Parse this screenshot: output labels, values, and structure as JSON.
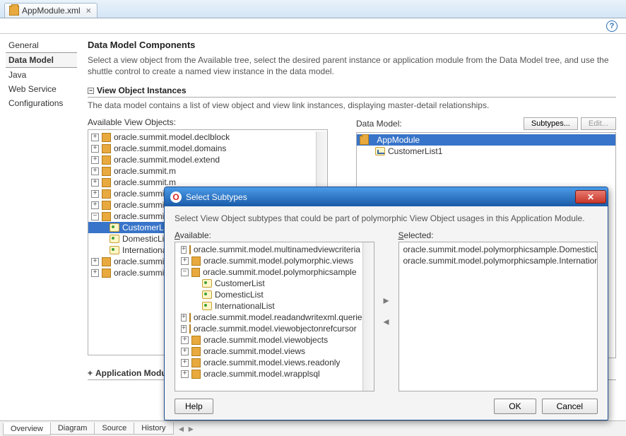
{
  "file_tab": {
    "label": "AppModule.xml",
    "close": "×"
  },
  "leftnav": {
    "general": "General",
    "data_model": "Data Model",
    "java": "Java",
    "web_service": "Web Service",
    "configurations": "Configurations"
  },
  "main": {
    "title": "Data Model Components",
    "desc": "Select a view object from the Available tree, select the desired parent instance or application module from the Data Model tree, and use the shuttle control to create a named view instance in the data model.",
    "section_vo": "View Object Instances",
    "section_vo_desc": "The data model contains a list of view object and view link instances, displaying master-detail relationships.",
    "avail_label": "Available View Objects:",
    "dm_label": "Data Model:",
    "btn_subtypes": "Subtypes...",
    "btn_edit": "Edit...",
    "section_ami": "Application Module Instances",
    "avail_tree": [
      "oracle.summit.model.declblock",
      "oracle.summit.model.domains",
      "oracle.summit.model.extend",
      "oracle.summit.m",
      "oracle.summit.m",
      "oracle.summit.m",
      "oracle.summit.m"
    ],
    "avail_tree_open": "oracle.summit.m",
    "avail_children": {
      "customer": "CustomerLis",
      "domestic": "DomesticList",
      "international": "Internationa"
    },
    "avail_tree_tail": [
      "oracle.summit.m",
      "oracle.summit.m"
    ],
    "dm_root": "AppModule",
    "dm_child": "CustomerList1"
  },
  "modal": {
    "title": "Select Subtypes",
    "desc": "Select View Object subtypes that could be part of polymorphic View Object usages in this Application Module.",
    "available_label": "Available:",
    "selected_label": "Selected:",
    "available_items": [
      "oracle.summit.model.multinamedviewcriteria",
      "oracle.summit.model.polymorphic.views"
    ],
    "available_open": "oracle.summit.model.polymorphicsample",
    "available_children": [
      "CustomerList",
      "DomesticList",
      "InternationalList"
    ],
    "available_tail": [
      "oracle.summit.model.readandwritexml.queries",
      "oracle.summit.model.viewobjectonrefcursor",
      "oracle.summit.model.viewobjects",
      "oracle.summit.model.views",
      "oracle.summit.model.views.readonly",
      "oracle.summit.model.wrapplsql"
    ],
    "selected_items": [
      "oracle.summit.model.polymorphicsample.DomesticList",
      "oracle.summit.model.polymorphicsample.InternationalList"
    ],
    "help": "Help",
    "ok": "OK",
    "cancel": "Cancel"
  },
  "bottom_tabs": {
    "overview": "Overview",
    "diagram": "Diagram",
    "source": "Source",
    "history": "History"
  }
}
